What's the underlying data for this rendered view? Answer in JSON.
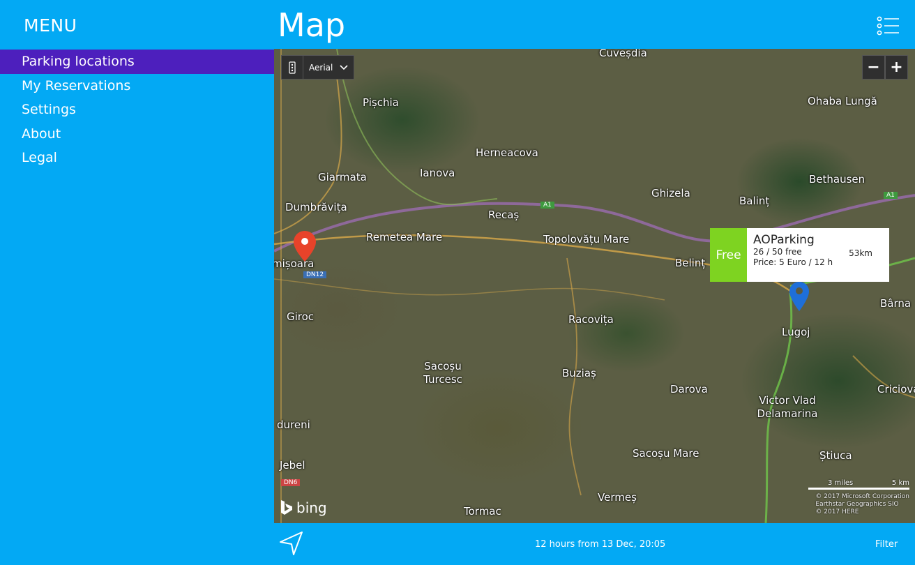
{
  "sidebar": {
    "title": "MENU",
    "items": [
      {
        "label": "Parking locations"
      },
      {
        "label": "My Reservations"
      },
      {
        "label": "Settings"
      },
      {
        "label": "About"
      },
      {
        "label": "Legal"
      }
    ]
  },
  "header": {
    "title": "Map"
  },
  "map": {
    "style_selector": "Aerial",
    "zoom_out": "−",
    "zoom_in": "+",
    "places": [
      "Cuveșdia",
      "Pișchia",
      "Ohaba Lungă",
      "Herneacova",
      "Ianova",
      "Giarmata",
      "Ghizela",
      "Bethausen",
      "Dumbrăvița",
      "Balinț",
      "Recaș",
      "Remetea Mare",
      "Topolovățu Mare",
      "Belinț",
      "mișoara",
      "Giroc",
      "Racovița",
      "Bârna",
      "Lugoj",
      "Sacoșu Turcesc",
      "Buziaș",
      "Darova",
      "Criciova",
      "Victor Vlad Delamarina",
      "dureni",
      "Jebel",
      "Sacoșu Mare",
      "Știuca",
      "Vermeș",
      "Tormac"
    ],
    "road_labels": [
      "A1",
      "A1",
      "DN12",
      "DN6"
    ],
    "popup": {
      "status": "Free",
      "name": "AOParking",
      "availability": "26 / 50 free",
      "price": "Price: 5 Euro / 12 h",
      "distance": "53km"
    },
    "brand": "bing",
    "scale": {
      "miles": "3 miles",
      "km": "5 km"
    },
    "copyright": [
      "© 2017 Microsoft Corporation",
      "Earthstar Geographics SIO",
      "© 2017 HERE"
    ]
  },
  "footer": {
    "time_text": "12 hours from 13 Dec, 20:05",
    "filter_label": "Filter"
  },
  "colors": {
    "accent": "#03a9f4",
    "selected": "#4d1fbd",
    "free": "#7ed321"
  }
}
